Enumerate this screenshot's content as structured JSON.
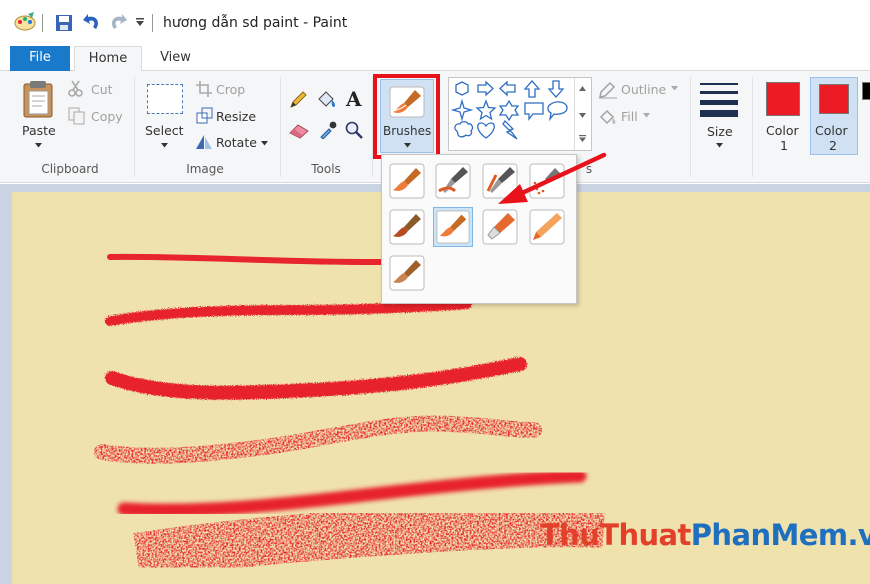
{
  "window": {
    "title": "hương dẫn sd paint - Paint"
  },
  "tabs": {
    "file": "File",
    "home": "Home",
    "view": "View"
  },
  "clipboard": {
    "paste": "Paste",
    "cut": "Cut",
    "copy": "Copy",
    "label": "Clipboard"
  },
  "image": {
    "select": "Select",
    "crop": "Crop",
    "resize": "Resize",
    "rotate": "Rotate",
    "label": "Image"
  },
  "tools": {
    "label": "Tools",
    "text_glyph": "A"
  },
  "brushes": {
    "label": "Brushes"
  },
  "shapes": {
    "outline": "Outline",
    "fill": "Fill",
    "label_tail": "s"
  },
  "size": {
    "label": "Size"
  },
  "colors": {
    "color1_a": "Color",
    "color1_b": "1",
    "color2_a": "Color",
    "color2_b": "2",
    "color1_value": "#ed1c24",
    "color2_value": "#ed1c24"
  },
  "watermark": {
    "part1": "ThuThuat",
    "part2": "PhanMem",
    "part3": ".vn",
    "color1": "#e2402a",
    "color2": "#1f6fc0"
  },
  "accent": {
    "highlight": "#e8121a",
    "canvas": "#efe2ad",
    "stroke": "#e8242c"
  }
}
